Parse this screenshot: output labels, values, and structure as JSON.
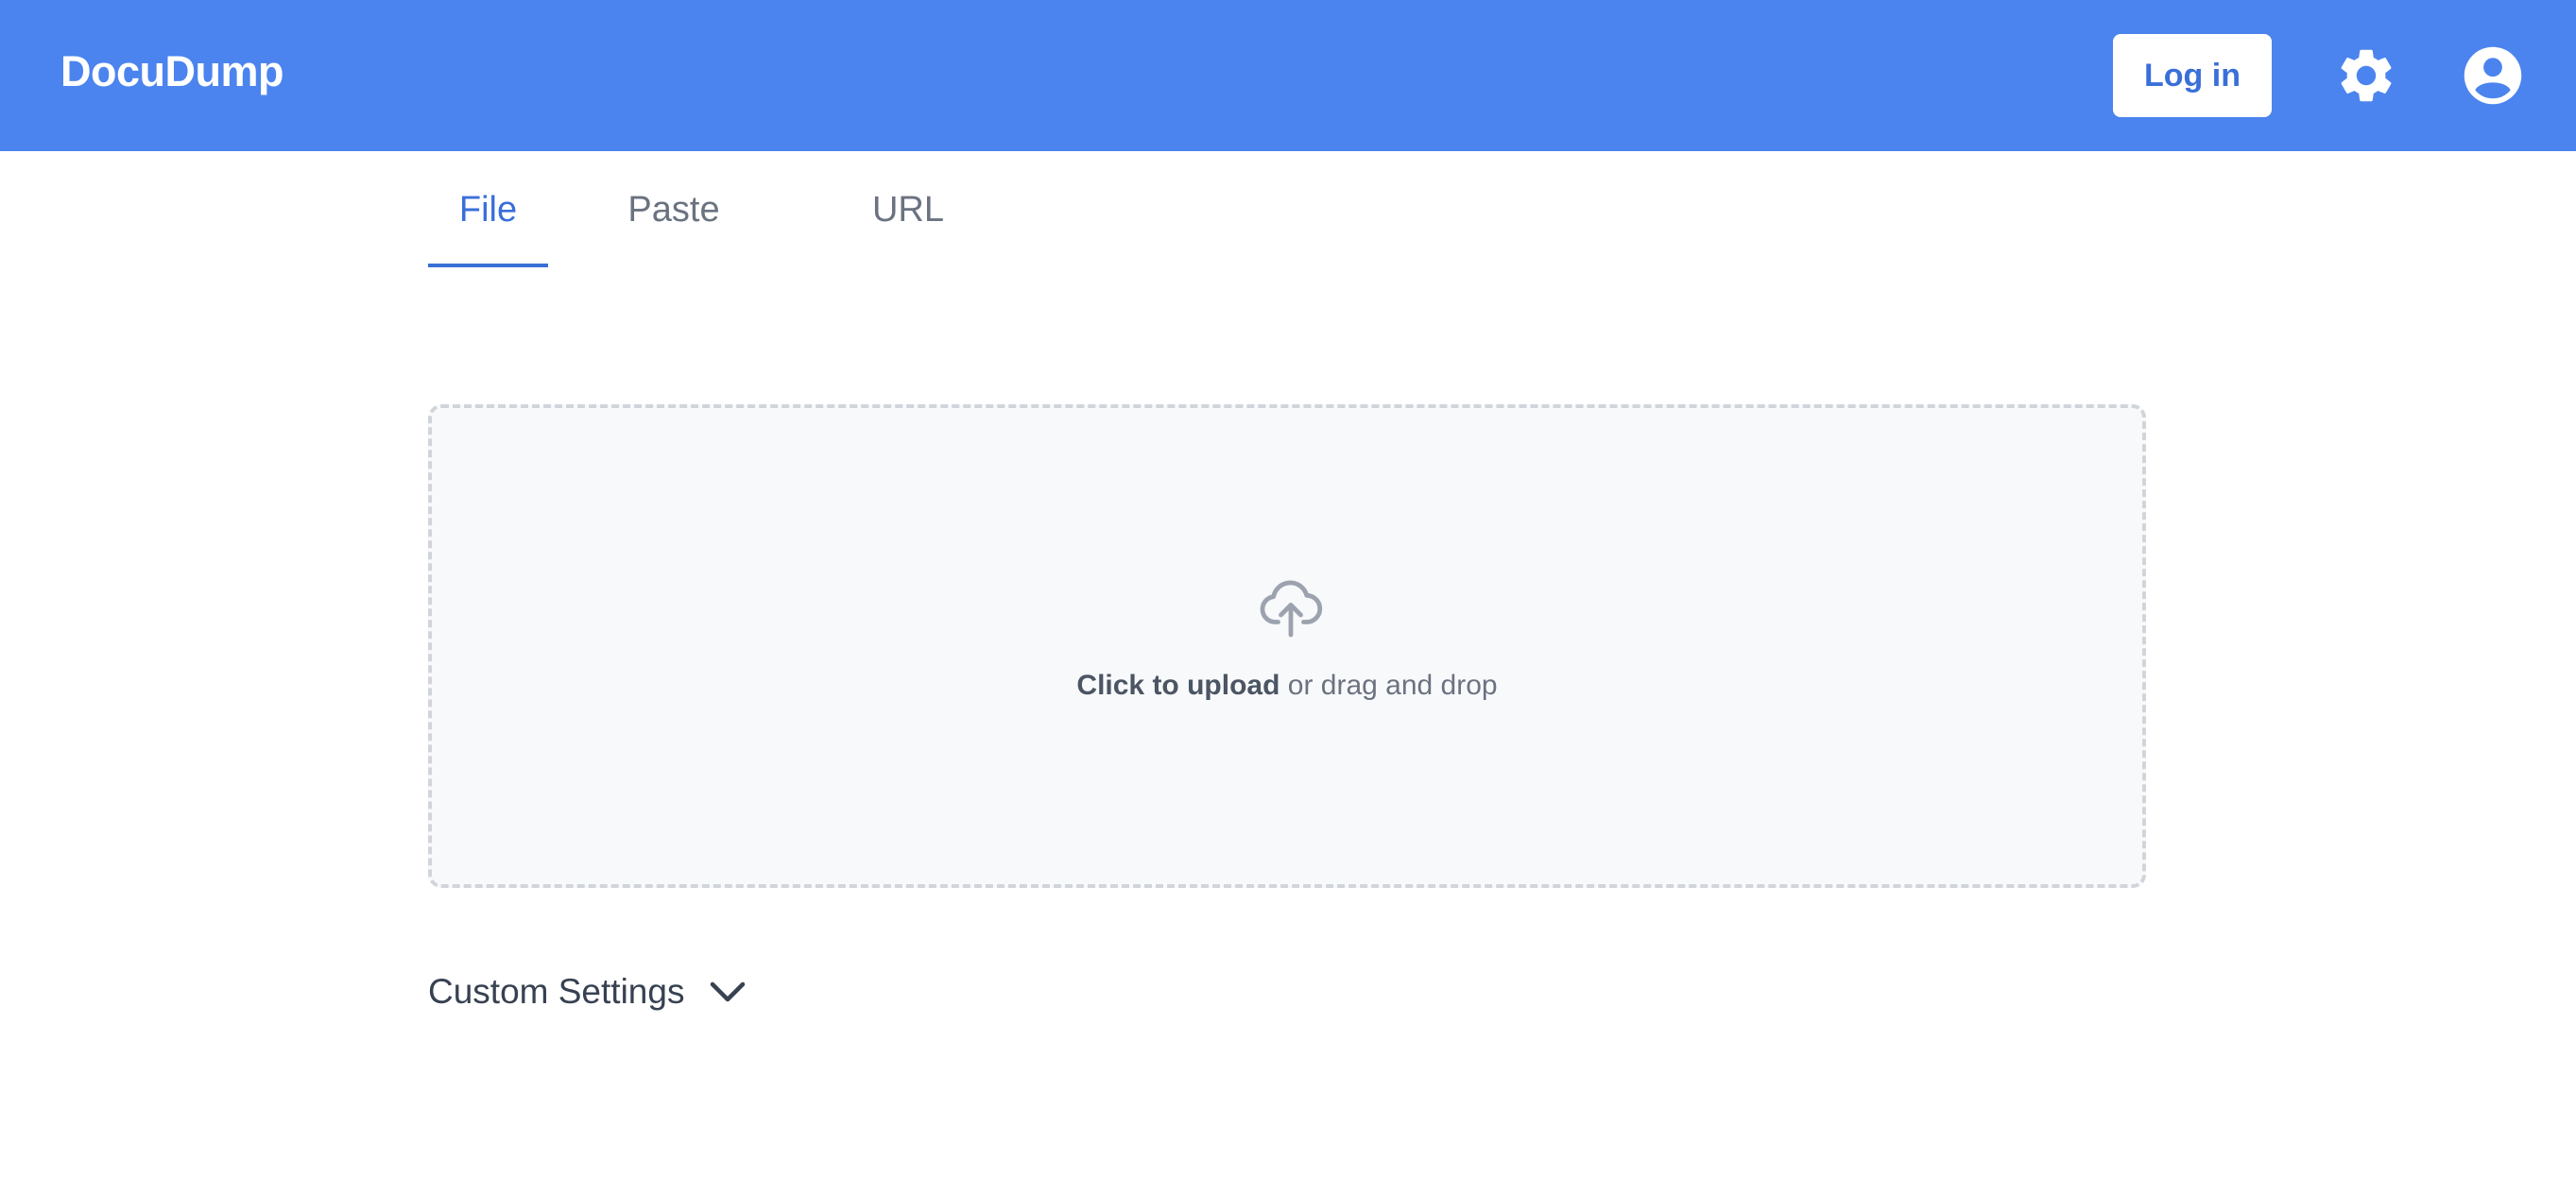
{
  "app": {
    "brand": "DocuDump"
  },
  "header": {
    "login_label": "Log in",
    "icons": [
      "gear-icon",
      "user-circle-icon"
    ]
  },
  "tabs": [
    {
      "label": "File",
      "active": true
    },
    {
      "label": "Paste",
      "active": false
    },
    {
      "label": "URL",
      "active": false
    }
  ],
  "upload": {
    "icon": "cloud-upload-icon",
    "primary_text": "Click to upload",
    "secondary_text": " or drag and drop"
  },
  "custom_settings": {
    "label": "Custom Settings",
    "icon": "chevron-down-icon"
  },
  "colors": {
    "brand_blue": "#4b84ee",
    "accent": "#3a6fd8"
  }
}
